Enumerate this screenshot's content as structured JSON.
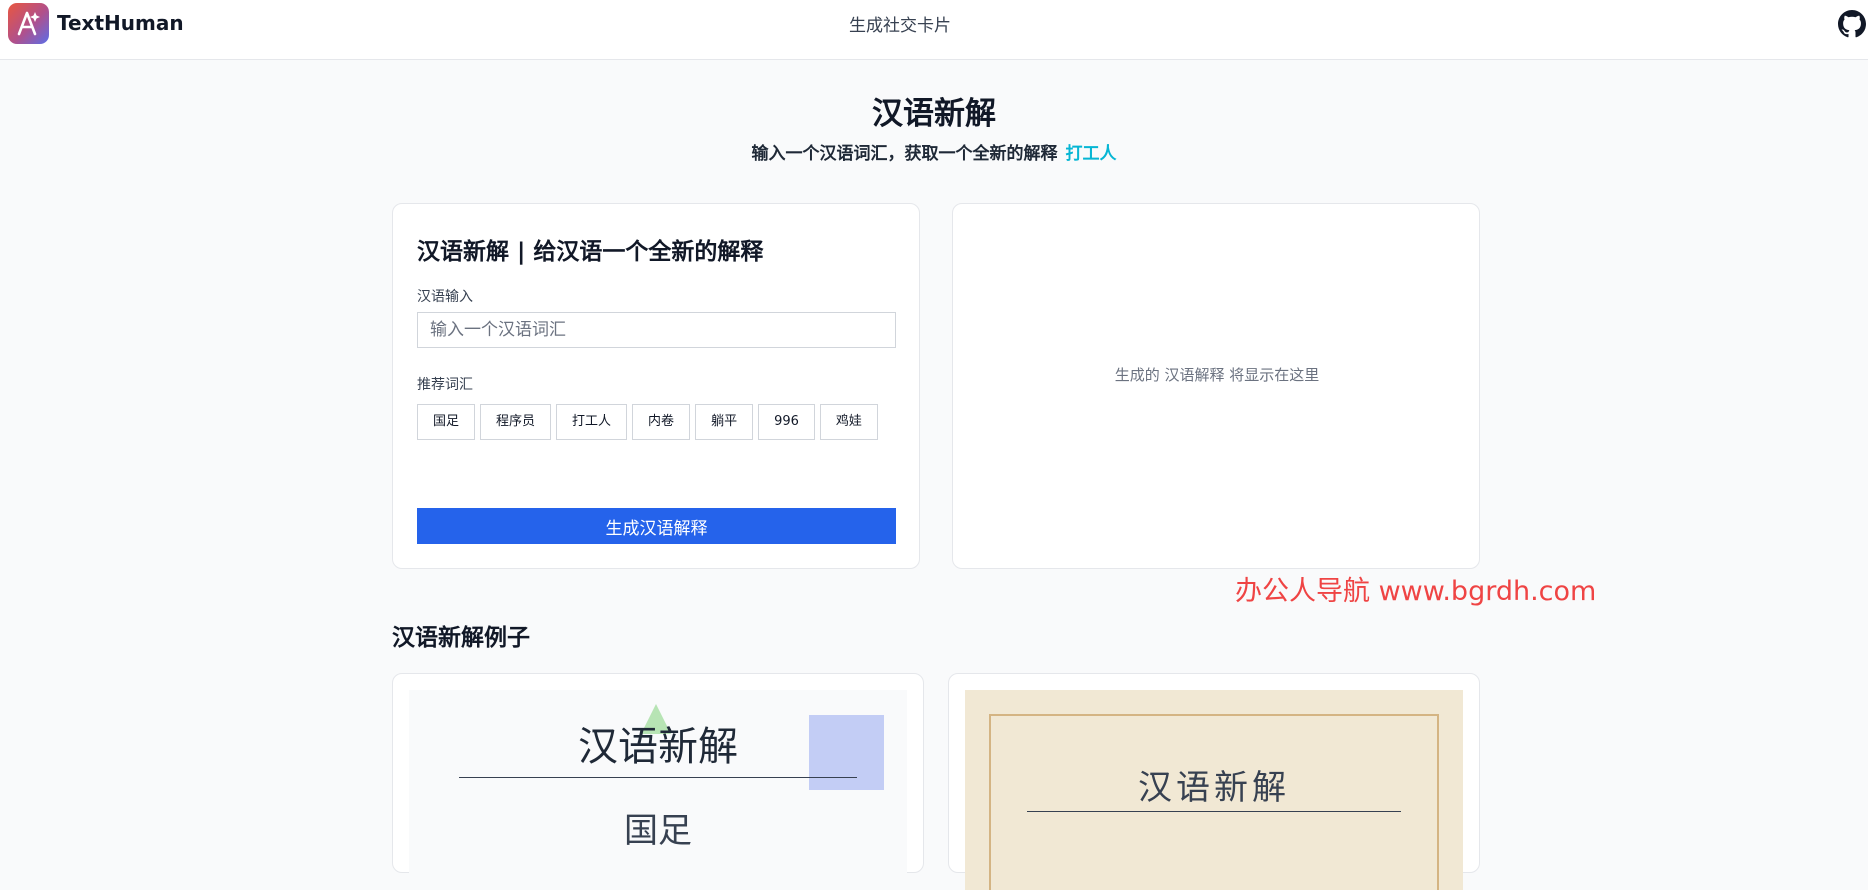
{
  "navbar": {
    "brand": "TextHuman",
    "center_link": "生成社交卡片",
    "github_icon": "github-icon"
  },
  "hero": {
    "title": "汉语新解",
    "subtitle": "输入一个汉语词汇，获取一个全新的解释",
    "highlight": "打工人"
  },
  "form": {
    "title": "汉语新解 | 给汉语一个全新的解释",
    "input_label": "汉语输入",
    "input_placeholder": "输入一个汉语词汇",
    "input_value": "",
    "suggest_label": "推荐词汇",
    "suggestions": [
      "国足",
      "程序员",
      "打工人",
      "内卷",
      "躺平",
      "996",
      "鸡娃"
    ],
    "submit_label": "生成汉语解释"
  },
  "result": {
    "placeholder": "生成的 汉语解释 将显示在这里"
  },
  "watermark": "办公人导航  www.bgrdh.com",
  "examples": {
    "title": "汉语新解例子",
    "cards": [
      {
        "title": "汉语新解",
        "word": "国足"
      },
      {
        "title": "汉语新解"
      }
    ]
  }
}
